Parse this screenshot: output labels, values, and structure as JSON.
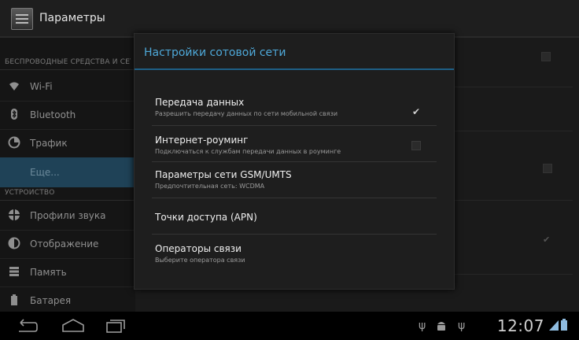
{
  "actionbar": {
    "title": "Параметры"
  },
  "left_pane": {
    "sections": [
      {
        "header": "БЕСПРОВОДНЫЕ СРЕДСТВА И СЕТИ"
      },
      {
        "header": "УСТРОЙСТВО"
      }
    ],
    "items": [
      {
        "label": "Wi-Fi",
        "icon": "wifi-icon"
      },
      {
        "label": "Bluetooth",
        "icon": "bluetooth-icon"
      },
      {
        "label": "Трафик",
        "icon": "data-usage-icon"
      },
      {
        "label": "Еще...",
        "icon": "",
        "selected": true
      },
      {
        "label": "Профили звука",
        "icon": "sound-icon"
      },
      {
        "label": "Отображение",
        "icon": "display-icon"
      },
      {
        "label": "Память",
        "icon": "storage-icon"
      },
      {
        "label": "Батарея",
        "icon": "battery-icon"
      }
    ]
  },
  "dialog": {
    "title": "Настройки сотовой сети",
    "options": [
      {
        "title": "Передача данных",
        "summary": "Разрешить передачу данных по сети мобильной связи",
        "checked": true
      },
      {
        "title": "Интернет-роуминг",
        "summary": "Подключаться к службам передачи данных в роуминге",
        "checked": false
      },
      {
        "title": "Параметры сети GSM/UMTS",
        "summary": "Предпочтительная сеть: WCDMA"
      },
      {
        "title": "Точки доступа (APN)",
        "summary": ""
      },
      {
        "title": "Операторы связи",
        "summary": "Выберите оператора связи"
      }
    ]
  },
  "statusbar": {
    "time": "12:07"
  },
  "colors": {
    "accent": "#33b5e5",
    "selection": "#1f4257"
  }
}
